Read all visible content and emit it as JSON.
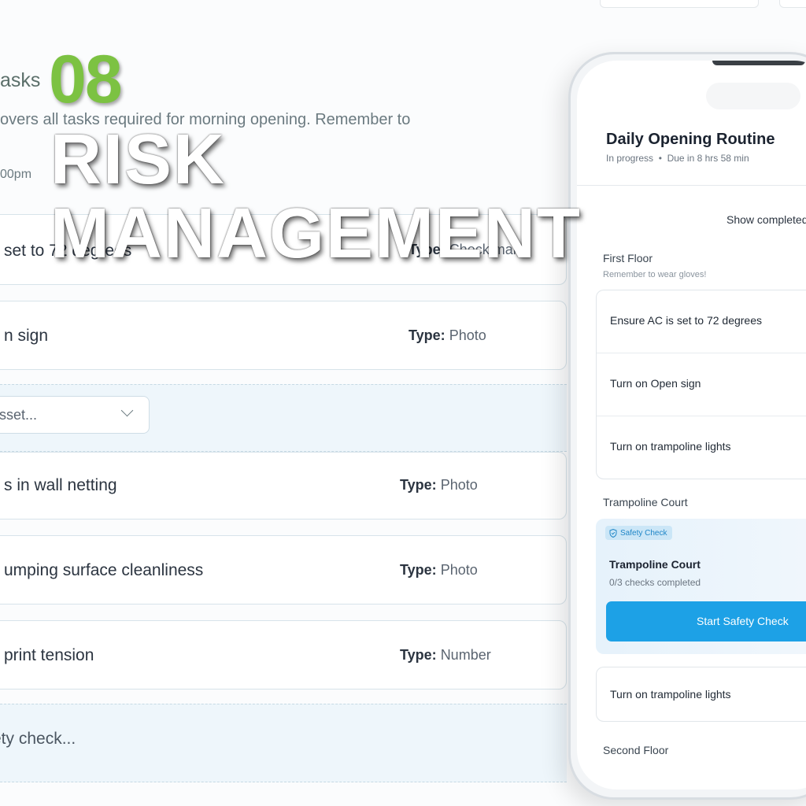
{
  "background_app": {
    "heading": "asks",
    "description": "overs all tasks required for morning opening. Remember to",
    "time": "00pm",
    "rows": [
      {
        "title": "set to 72 degrees",
        "type_label": "Type:",
        "type_value": "Check mark"
      },
      {
        "title": "n sign",
        "type_label": "Type:",
        "type_value": "Photo"
      },
      {
        "title": "s in wall netting",
        "type_label": "Type:",
        "type_value": "Photo"
      },
      {
        "title": "umping surface cleanliness",
        "type_label": "Type:",
        "type_value": "Photo"
      },
      {
        "title": "print tension",
        "type_label": "Type:",
        "type_value": "Number"
      }
    ],
    "asset_select_placeholder": "asset...",
    "safety_check_drop": "ety check..."
  },
  "overlay": {
    "number": "08",
    "line1": "RISK",
    "line2": "MANAGEMENT"
  },
  "phone": {
    "title": "Daily Opening Routine",
    "status": "In progress",
    "separator": "•",
    "due": "Due in 8 hrs 58 min",
    "show_completed": "Show completed",
    "sections": {
      "first_floor": "First Floor",
      "first_floor_note": "Remember to wear gloves!",
      "trampoline_court": "Trampoline Court",
      "second_floor": "Second Floor"
    },
    "first_floor_items": [
      "Ensure AC is set to 72 degrees",
      "Turn on Open sign",
      "Turn on trampoline lights"
    ],
    "safety_card": {
      "badge": "Safety Check",
      "title": "Trampoline Court",
      "progress_text": "0/3 checks completed",
      "button": "Start Safety Check"
    },
    "after_court_item": "Turn on trampoline lights"
  },
  "colors": {
    "overlay_number": "#7cc242",
    "primary_button": "#1da1e6",
    "badge_bg": "#cbe6f7"
  },
  "icons": {
    "safety_badge": "shield-check-icon",
    "select": "chevron-down-icon"
  }
}
